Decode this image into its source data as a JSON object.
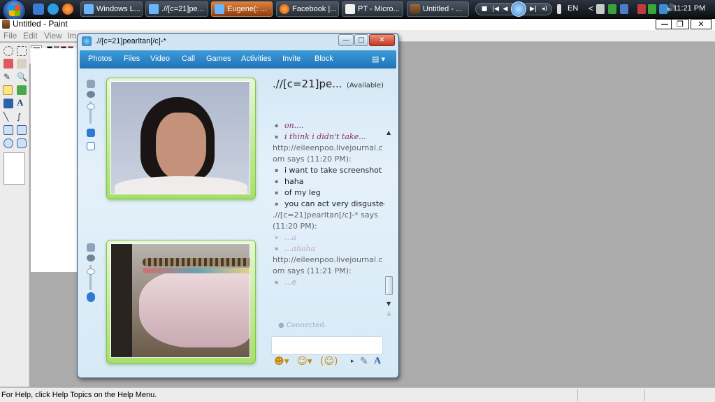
{
  "taskbar": {
    "tasks": [
      {
        "label": "Windows L...",
        "active": false
      },
      {
        "label": ".//[c=21]pe...",
        "active": false
      },
      {
        "label": "Eugene(: ...",
        "active": true
      },
      {
        "label": "Facebook |...",
        "active": false
      },
      {
        "label": "PT - Micro...",
        "active": false
      },
      {
        "label": "Untitled - ...",
        "active": false
      }
    ],
    "language": "EN",
    "clock": "11:21 PM"
  },
  "paint": {
    "title": "Untitled - Paint",
    "menu": [
      "File",
      "Edit",
      "View",
      "Im"
    ],
    "status_text": "For Help, click Help Topics on the Help Menu.",
    "controls": {
      "minimize": "—",
      "restore": "❐",
      "close": "✕"
    }
  },
  "messenger": {
    "title": ".//[c=21]pearltan[/c]-*",
    "nav": [
      "Photos",
      "Files",
      "Video",
      "Call",
      "Games",
      "Activities",
      "Invite",
      "Block"
    ],
    "contact_name": ".//[c=21]pe...",
    "contact_status": "(Available)",
    "chat": [
      {
        "kind": "msg",
        "text": "on....",
        "style": "ital"
      },
      {
        "kind": "msg",
        "text": "i think i didn't take...",
        "style": "ital"
      },
      {
        "kind": "hdr",
        "text": "http://eileenpoo.livejournal.com says (11:20 PM):"
      },
      {
        "kind": "msg",
        "text": "i want to take screenshot"
      },
      {
        "kind": "msg",
        "text": "haha"
      },
      {
        "kind": "msg",
        "text": "of my leg"
      },
      {
        "kind": "msg",
        "text": "you can act very disgusted"
      },
      {
        "kind": "hdr",
        "text": ".//[c=21]pearltan[/c]-* says (11:20 PM):"
      },
      {
        "kind": "msg",
        "text": "...a",
        "style": "ital",
        "fade": true
      },
      {
        "kind": "msg",
        "text": "",
        "fade": true
      },
      {
        "kind": "msg",
        "text": "...ahaha",
        "style": "ital",
        "fade": true
      },
      {
        "kind": "hdr",
        "text": "http://eileenpoo.livejournal.com says (11:21 PM):"
      },
      {
        "kind": "msg",
        "text": "",
        "fade": true
      },
      {
        "kind": "msg",
        "text": "...e",
        "fade": true
      }
    ],
    "connected": "Connected."
  }
}
